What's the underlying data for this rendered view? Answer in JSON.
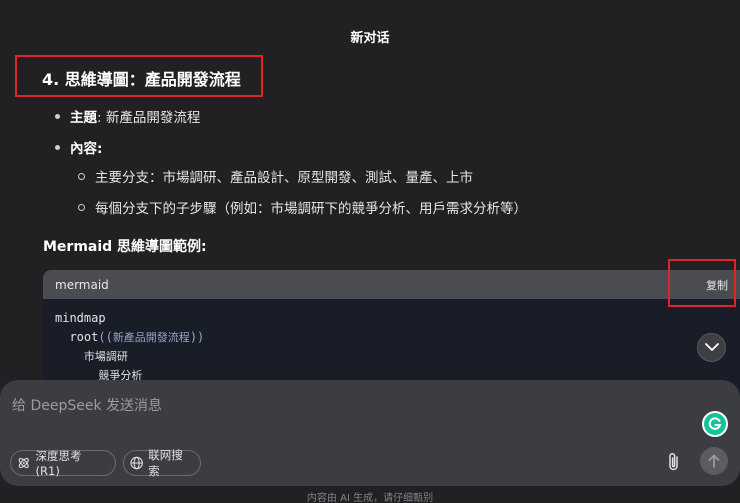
{
  "header": {
    "title": "新对话"
  },
  "content": {
    "heading": "4. 思維導圖：產品開發流程",
    "topic_label": "主題",
    "topic_value": ": 新產品開發流程",
    "content_label": "內容:",
    "sub_items": [
      "主要分支：市場調研、產品設計、原型開發、測試、量產、上市",
      "每個分支下的子步驟（例如：市場調研下的競爭分析、用戶需求分析等）"
    ],
    "example_label": "Mermaid 思維導圖範例:"
  },
  "code_block": {
    "language": "mermaid",
    "copy_label": "复制",
    "line1": "mindmap",
    "line2_prefix": "root",
    "line2_open": "((",
    "line2_text": "新產品開發流程",
    "line2_close": "))",
    "line3": "市場調研",
    "line4": "競爭分析"
  },
  "composer": {
    "placeholder": "给 DeepSeek 发送消息",
    "deep_think_label": "深度思考 (R1)",
    "web_search_label": "联网搜索"
  },
  "footer": {
    "disclaimer": "内容由 AI 生成，请仔细甄别"
  },
  "colors": {
    "highlight": "#e0242c",
    "grammarly": "#15c39a"
  },
  "icons": [
    "chevron-down-icon",
    "atom-icon",
    "globe-icon",
    "paperclip-icon",
    "arrow-up-icon",
    "grammarly-icon"
  ]
}
